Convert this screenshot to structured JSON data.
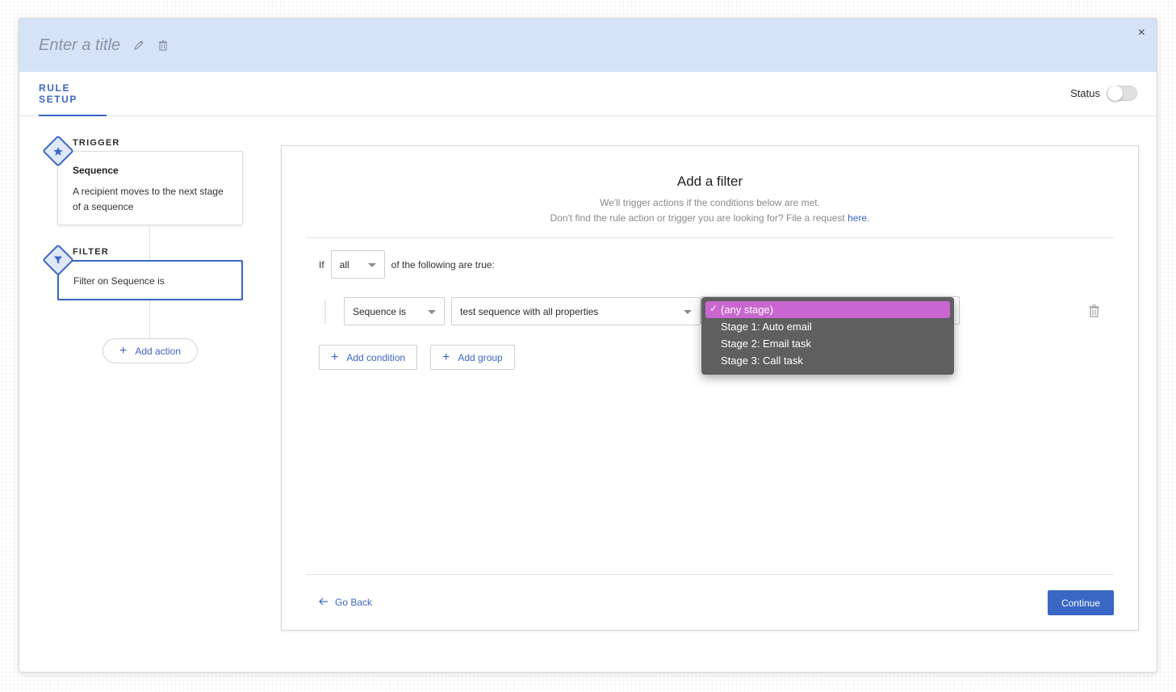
{
  "header": {
    "title_placeholder": "Enter a title",
    "icons": [
      "pencil-icon",
      "trash-icon"
    ],
    "close_label": "×"
  },
  "tabs": {
    "rule_setup": "RULE SETUP"
  },
  "status": {
    "label": "Status",
    "enabled": false
  },
  "flow": {
    "trigger": {
      "label": "TRIGGER",
      "icon": "star-icon",
      "title": "Sequence",
      "description": "A recipient moves to the next stage of a sequence"
    },
    "filter": {
      "label": "FILTER",
      "icon": "funnel-icon",
      "description": "Filter on Sequence is"
    },
    "add_action": "Add action"
  },
  "panel": {
    "title": "Add a filter",
    "subtitle1": "We'll trigger actions if the conditions below are met.",
    "subtitle2": "Don't find the rule action or trigger you are looking for? File a request",
    "subtitle_link": "here",
    "subtitle_end": ".",
    "if_label": "If",
    "match_value": "all",
    "following": "of the following are true:",
    "condition_field": "Sequence is",
    "condition_value": "test sequence with all properties",
    "add_condition": "Add condition",
    "add_group": "Add group",
    "go_back": "Go Back",
    "continue": "Continue"
  },
  "stage_dropdown": {
    "options": [
      "(any stage)",
      "Stage 1: Auto email",
      "Stage 2: Email task",
      "Stage 3: Call task"
    ],
    "selected_index": 0,
    "check": "✓"
  },
  "colors": {
    "accent": "#3a66c5",
    "header_bg": "#d6e3f6",
    "dropdown_bg": "#5f5f5f",
    "dropdown_highlight": "#c966cf"
  }
}
